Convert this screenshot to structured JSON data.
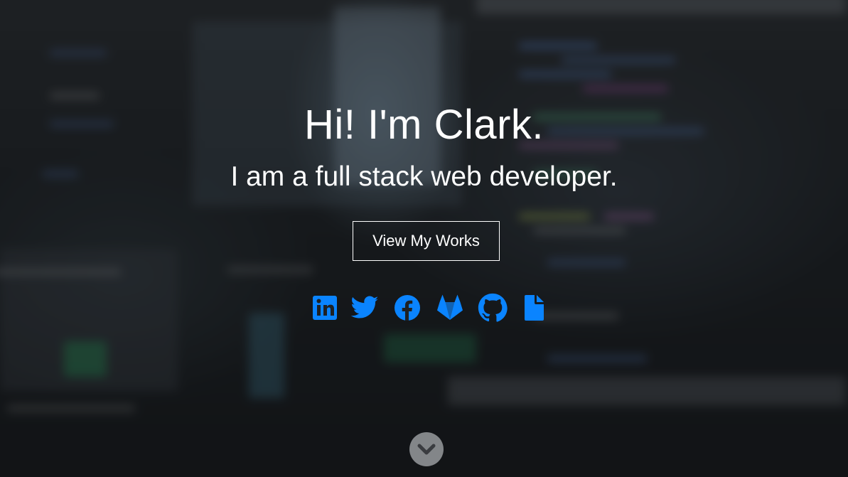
{
  "hero": {
    "title": "Hi! I'm Clark.",
    "subtitle": "I am a full stack web developer.",
    "cta_label": "View My Works"
  },
  "socials": [
    {
      "name": "linkedin",
      "icon": "linkedin-icon"
    },
    {
      "name": "twitter",
      "icon": "twitter-icon"
    },
    {
      "name": "facebook",
      "icon": "facebook-icon"
    },
    {
      "name": "gitlab",
      "icon": "gitlab-icon"
    },
    {
      "name": "github",
      "icon": "github-icon"
    },
    {
      "name": "resume",
      "icon": "file-icon"
    }
  ],
  "scroll": {
    "icon": "chevron-down-icon"
  },
  "colors": {
    "accent": "#0a84ff",
    "text": "#ffffff",
    "scroll_button": "#a9abaf"
  }
}
